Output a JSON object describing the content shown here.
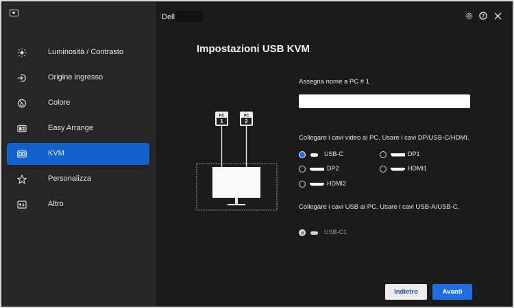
{
  "window": {
    "title": "Dell"
  },
  "sidebar": {
    "items": [
      {
        "label": "Luminosità / Contrasto",
        "icon": "brightness-icon"
      },
      {
        "label": "Origine ingresso",
        "icon": "input-source-icon"
      },
      {
        "label": "Colore",
        "icon": "color-icon"
      },
      {
        "label": "Easy Arrange",
        "icon": "easy-arrange-icon"
      },
      {
        "label": "KVM",
        "icon": "kvm-icon",
        "active": true
      },
      {
        "label": "Personalizza",
        "icon": "star-icon"
      },
      {
        "label": "Altro",
        "icon": "other-icon"
      }
    ]
  },
  "main": {
    "title": "Impostazioni USB KVM",
    "name_label": "Assegna nome a PC # 1",
    "name_value": "",
    "video_instruction": "Collegare i cavi video ai PC. Usare i cavi DP/USB-C/HDMI.",
    "video_options": [
      {
        "label": "USB-C",
        "port": "usb-c",
        "checked": true
      },
      {
        "label": "DP1",
        "port": "dp",
        "checked": false
      },
      {
        "label": "DP2",
        "port": "dp",
        "checked": false
      },
      {
        "label": "HDMI1",
        "port": "hdmi",
        "checked": false
      },
      {
        "label": "HDMI2",
        "port": "hdmi",
        "checked": false
      }
    ],
    "usb_instruction": "Collegare i cavi USB ai PC. Usare i cavi USB-A/USB-C.",
    "usb_options": [
      {
        "label": "USB-C1",
        "port": "usb-c",
        "checked": true,
        "disabled": true
      }
    ],
    "diagram": {
      "pc1_label": "PC",
      "pc1_num": "1",
      "pc2_label": "PC",
      "pc2_num": "2"
    },
    "buttons": {
      "back": "Indietro",
      "next": "Avanti"
    }
  },
  "colors": {
    "accent": "#1f6fe0",
    "sidebar_bg": "#262626",
    "main_bg": "#1b1b1b",
    "active_item": "#1462c9"
  }
}
